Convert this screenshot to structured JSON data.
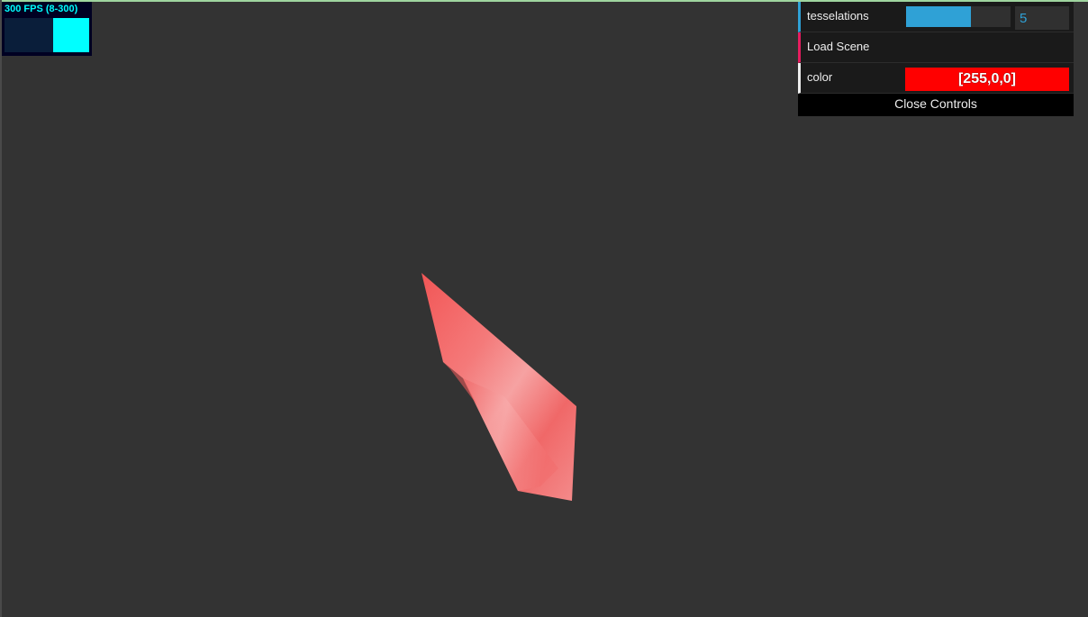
{
  "stats": {
    "fps_text": "300 FPS (8-300)",
    "fps_value": 300,
    "fps_min": 8,
    "fps_max": 300
  },
  "gui": {
    "controllers": [
      {
        "type": "number",
        "label": "tesselations",
        "value": "5",
        "slider_fraction": 0.62
      },
      {
        "type": "function",
        "label": "Load Scene"
      },
      {
        "type": "color",
        "label": "color",
        "value": "[255,0,0]",
        "swatch": "#ff0000"
      }
    ],
    "close_label": "Close Controls"
  },
  "colors": {
    "background": "#333333",
    "accent_number": "#2fa1d6",
    "accent_function": "#e61d5f",
    "mesh": "#f06a6a"
  },
  "scene": {
    "object": "red-shaded-mesh"
  }
}
